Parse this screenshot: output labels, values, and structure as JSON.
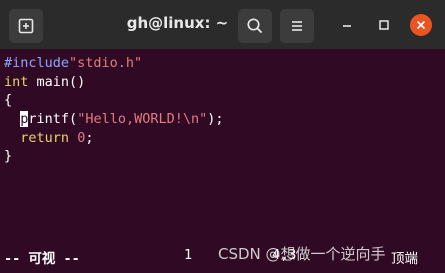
{
  "window": {
    "title": "gh@linux: ~",
    "icons": {
      "new_tab": "new-tab-icon",
      "search": "search-icon",
      "menu": "hamburger-menu-icon",
      "minimize": "minimize-icon",
      "maximize": "maximize-icon",
      "close": "close-icon"
    },
    "accent": "#e95420"
  },
  "editor": {
    "lines": [
      [
        "#include",
        "\"stdio.h\""
      ],
      [
        "int",
        " main()"
      ],
      [
        "{"
      ],
      [
        "  ",
        "p",
        "rintf(",
        "\"Hello,WORLD!\\n\"",
        ");"
      ],
      [
        "  ",
        "return",
        " ",
        "0",
        ";"
      ],
      [
        "}"
      ]
    ],
    "status": {
      "mode": "-- 可视 --",
      "selection_count": "1",
      "cursor_position": "4,3",
      "scroll": "顶端"
    }
  },
  "watermark": "CSDN @想做一个逆向手",
  "colors": {
    "background": "#300a24",
    "titlebar": "#2b2b2b",
    "preprocessor": "#8fa6ff",
    "string": "#e27c7c",
    "keyword": "#e9d36a"
  }
}
